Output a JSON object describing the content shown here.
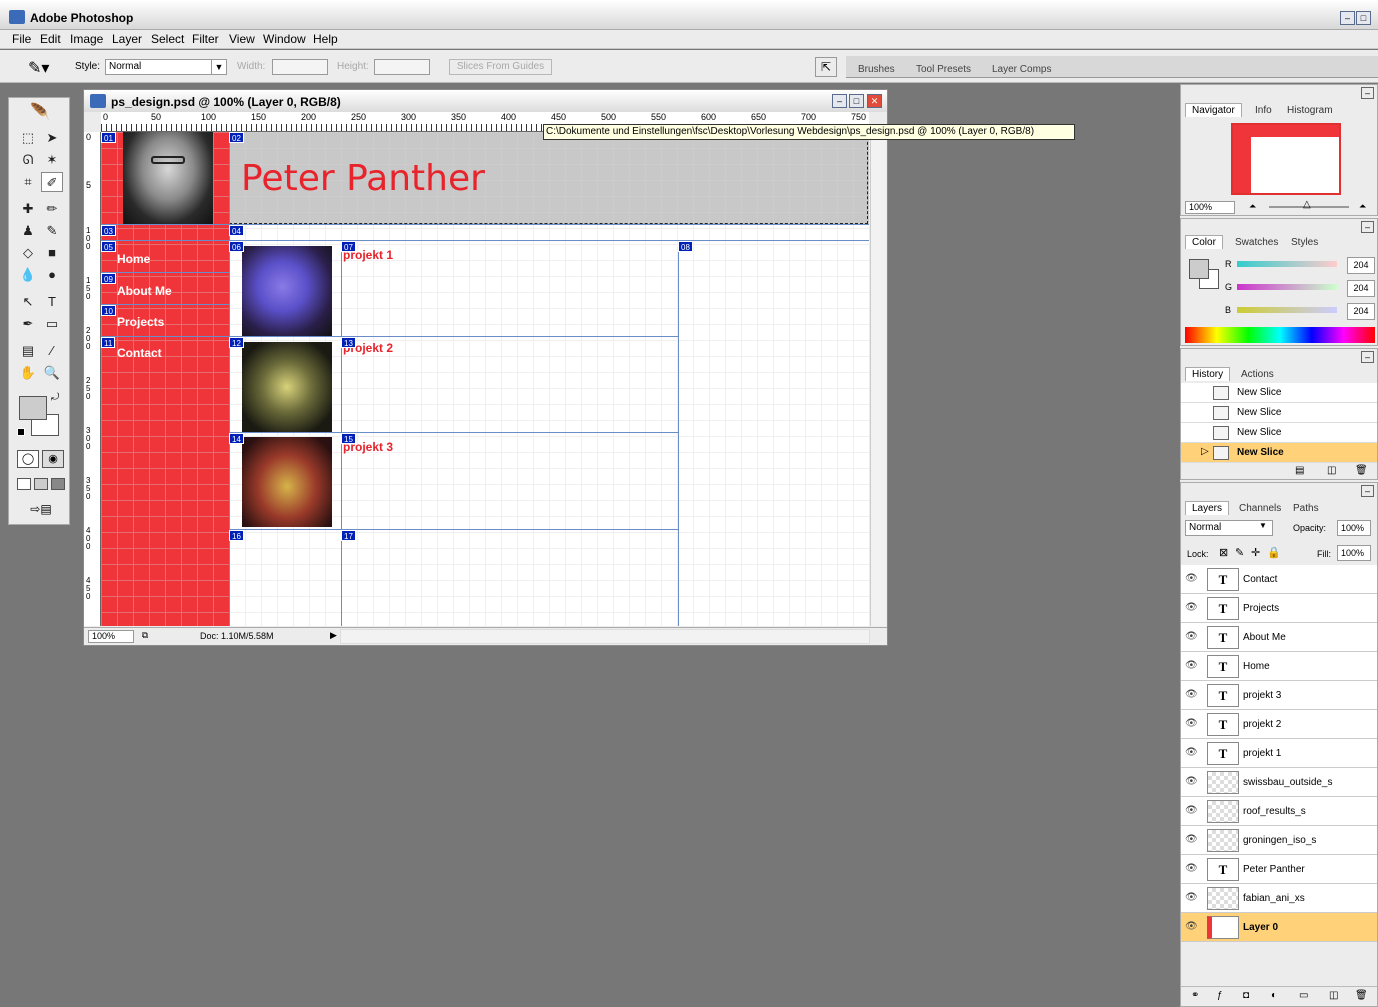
{
  "app": {
    "title": "Adobe Photoshop",
    "menu": [
      "File",
      "Edit",
      "Image",
      "Layer",
      "Select",
      "Filter",
      "View",
      "Window",
      "Help"
    ]
  },
  "options_bar": {
    "style_label": "Style:",
    "style_value": "Normal",
    "width_label": "Width:",
    "height_label": "Height:",
    "slices_button": "Slices From Guides",
    "palette_tabs": [
      "Brushes",
      "Tool Presets",
      "Layer Comps"
    ]
  },
  "document": {
    "title": "ps_design.psd @ 100% (Layer 0, RGB/8)",
    "tooltip": "C:\\Dokumente und Einstellungen\\fsc\\Desktop\\Vorlesung Webdesign\\ps_design.psd @ 100% (Layer 0, RGB/8)",
    "zoom": "100%",
    "doc_size": "Doc: 1.10M/5.58M",
    "ruler_h": [
      "0",
      "50",
      "100",
      "150",
      "200",
      "250",
      "300",
      "350",
      "400",
      "450",
      "500",
      "550",
      "600",
      "650",
      "700",
      "750"
    ],
    "ruler_v": [
      "0",
      "5",
      "1 0 0",
      "1 5 0",
      "2 0 0",
      "2 5 0",
      "3 0 0",
      "3 5 0",
      "4 0 0",
      "4 5 0"
    ]
  },
  "site": {
    "name": "Peter Panther",
    "nav": [
      "Home",
      "About Me",
      "Projects",
      "Contact"
    ],
    "projects": [
      "projekt 1",
      "projekt 2",
      "projekt 3"
    ],
    "slices": [
      "01",
      "02",
      "03",
      "04",
      "05",
      "06",
      "07",
      "08",
      "09",
      "10",
      "11",
      "12",
      "13",
      "14",
      "15",
      "16",
      "17"
    ]
  },
  "navigator": {
    "tabs": [
      "Navigator",
      "Info",
      "Histogram"
    ],
    "zoom": "100%"
  },
  "color": {
    "tabs": [
      "Color",
      "Swatches",
      "Styles"
    ],
    "channels": [
      {
        "label": "R",
        "value": "204"
      },
      {
        "label": "G",
        "value": "204"
      },
      {
        "label": "B",
        "value": "204"
      }
    ]
  },
  "history": {
    "tabs": [
      "History",
      "Actions"
    ],
    "items": [
      "New Slice",
      "New Slice",
      "New Slice",
      "New Slice"
    ]
  },
  "layers": {
    "tabs": [
      "Layers",
      "Channels",
      "Paths"
    ],
    "blend_mode": "Normal",
    "opacity_label": "Opacity:",
    "opacity": "100%",
    "lock_label": "Lock:",
    "fill_label": "Fill:",
    "fill": "100%",
    "items": [
      {
        "name": "Contact",
        "kind": "T"
      },
      {
        "name": "Projects",
        "kind": "T"
      },
      {
        "name": "About Me",
        "kind": "T"
      },
      {
        "name": "Home",
        "kind": "T"
      },
      {
        "name": "projekt 3",
        "kind": "T"
      },
      {
        "name": "projekt 2",
        "kind": "T"
      },
      {
        "name": "projekt 1",
        "kind": "T"
      },
      {
        "name": "swissbau_outside_s",
        "kind": "img"
      },
      {
        "name": "roof_results_s",
        "kind": "img"
      },
      {
        "name": "groningen_iso_s",
        "kind": "img"
      },
      {
        "name": "Peter Panther",
        "kind": "T"
      },
      {
        "name": "fabian_ani_xs",
        "kind": "img"
      },
      {
        "name": "Layer 0",
        "kind": "bg"
      }
    ]
  },
  "colors": {
    "site_red": "#f0353a",
    "header_gray": "#c8c8c8",
    "slice_blue": "#0020b8",
    "active_row": "#ffd27a"
  }
}
